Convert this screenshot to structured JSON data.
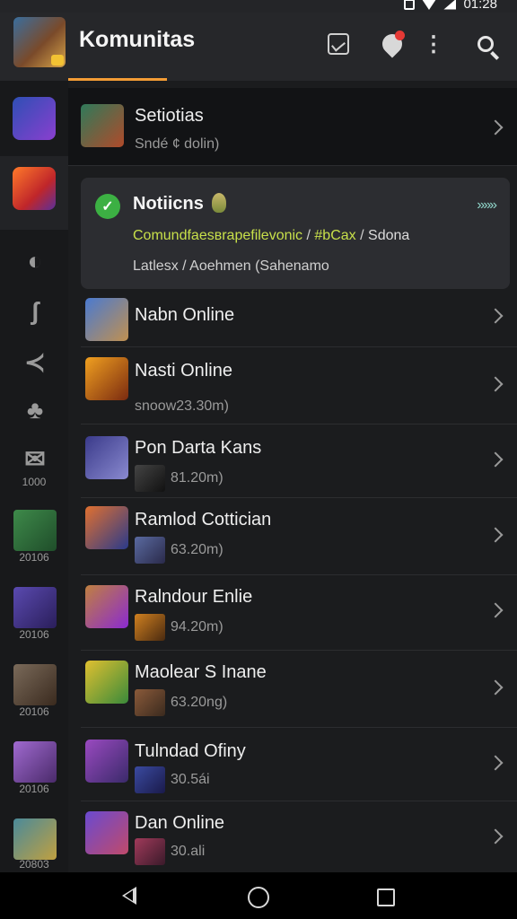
{
  "status": {
    "time": "01:28"
  },
  "appbar": {
    "title": "Komunitas"
  },
  "sidebar": {
    "labels": [
      "1000",
      "20106",
      "20106",
      "20106",
      "20106",
      "20803"
    ]
  },
  "first_row": {
    "title": "Setiotias",
    "sub": "Sndé ¢ dolin)"
  },
  "notification": {
    "title": "Notiicns",
    "arrows": "»»»",
    "line1_main": "Comundfaesвrapefilevonic",
    "line1_sep1": "/",
    "line1_tag": "#bCax",
    "line1_sep2": "/",
    "line1_tail": "Sdona",
    "line2": "Latlesx / Aoehmen (Sahenamo"
  },
  "rows": [
    {
      "title": "Nabn Online",
      "sub": ""
    },
    {
      "title": "Nasti Online",
      "sub": "snoow23.30m)"
    },
    {
      "title": "Pon Darta Kans",
      "sub": "81.20m)"
    },
    {
      "title": "Ramlod Cottician",
      "sub": "63.20m)"
    },
    {
      "title": "Ralndour Enlie",
      "sub": "94.20m)"
    },
    {
      "title": "Maolear S Inane",
      "sub": "63.20ng)"
    },
    {
      "title": "Tulndad Ofiny",
      "sub": "30.5ái"
    },
    {
      "title": "Dan Online",
      "sub": "30.ali"
    }
  ]
}
